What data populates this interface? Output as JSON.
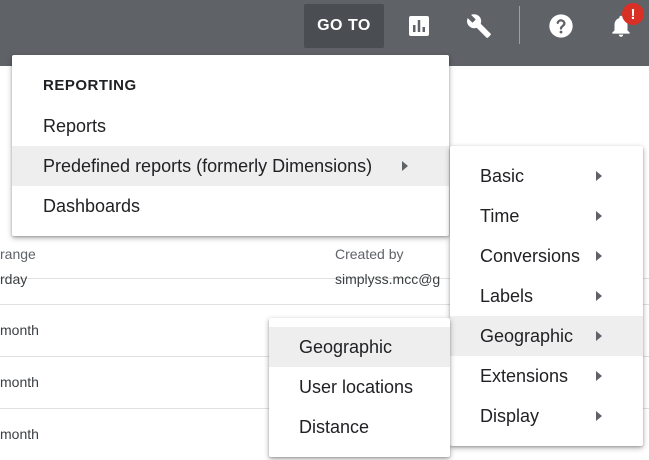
{
  "topbar": {
    "goto_label": "GO TO",
    "icons": [
      "reports-icon",
      "tools-icon",
      "help-icon",
      "notifications-icon"
    ],
    "notification_badge": "!"
  },
  "table": {
    "headers": {
      "range": "range",
      "created_by": "Created by"
    },
    "rows": [
      {
        "range": "rday",
        "created_by": "simplyss.mcc@g"
      },
      {
        "range": "month"
      },
      {
        "range": "month"
      },
      {
        "range": "month"
      }
    ]
  },
  "menu1": {
    "header": "REPORTING",
    "items": [
      "Reports",
      "Predefined reports (formerly Dimensions)",
      "Dashboards"
    ]
  },
  "menu2": {
    "items": [
      "Basic",
      "Time",
      "Conversions",
      "Labels",
      "Geographic",
      "Extensions",
      "Display"
    ]
  },
  "menu3": {
    "items": [
      "Geographic",
      "User locations",
      "Distance"
    ]
  },
  "colors": {
    "topbar": "#5f6368",
    "badge": "#d93025",
    "highlight": "#eeeeee"
  }
}
